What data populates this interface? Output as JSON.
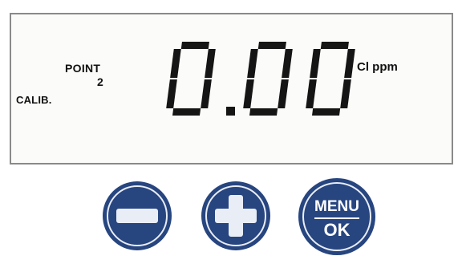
{
  "display": {
    "mode_label": "CALIB.",
    "point_label": "POINT",
    "point_number": "2",
    "reading": "0.00",
    "unit": "Cl ppm"
  },
  "buttons": {
    "minus": {
      "icon": "minus-icon"
    },
    "plus": {
      "icon": "plus-icon"
    },
    "menu": {
      "top_label": "MENU",
      "bottom_label": "OK"
    }
  },
  "colors": {
    "button_fill": "#27457f",
    "button_ring": "#e8edf6",
    "lcd_background": "#fbfbf9",
    "segment": "#151515"
  }
}
